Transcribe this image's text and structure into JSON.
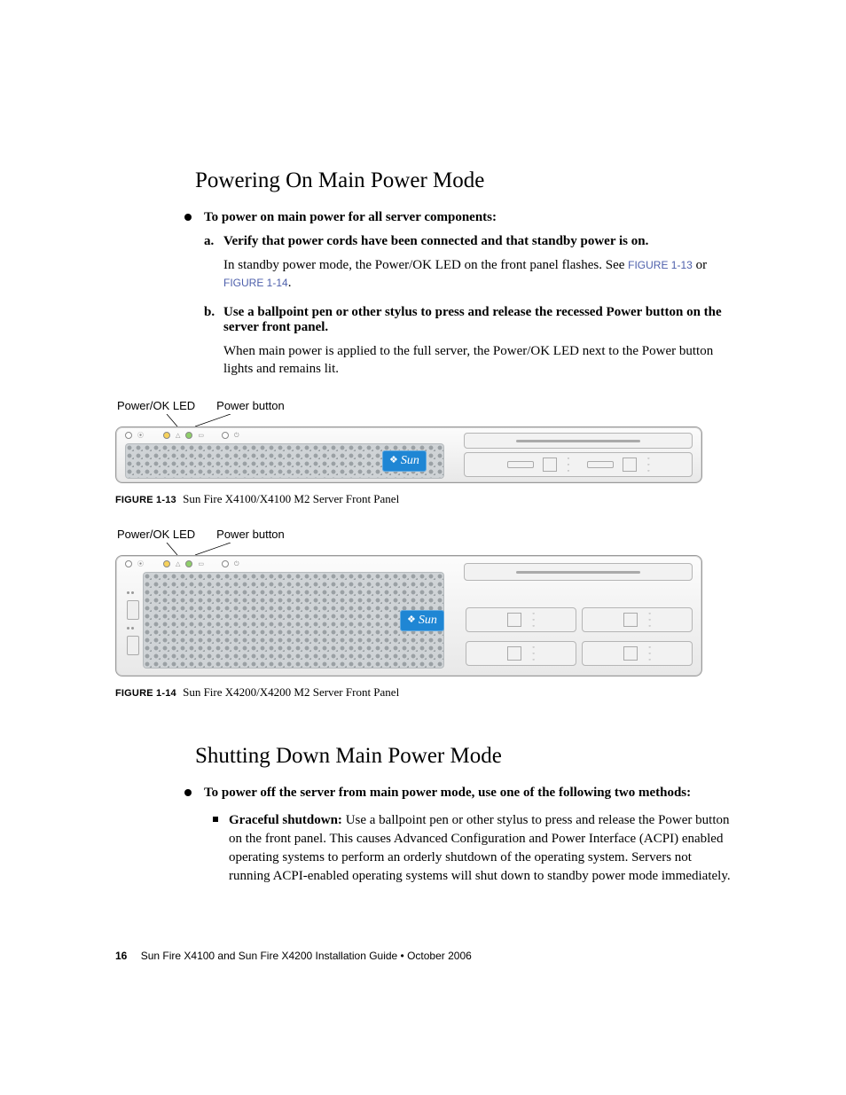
{
  "heading1": "Powering On Main Power Mode",
  "lead1": "To power on main power for all server components:",
  "steps": [
    {
      "marker": "a.",
      "head": "Verify that power cords have been connected and that standby power is on.",
      "body_pre": "In standby power mode, the Power/OK LED on the front panel flashes. See ",
      "xref1": "FIGURE 1-13",
      "mid": " or ",
      "xref2": "FIGURE 1-14",
      "post": "."
    },
    {
      "marker": "b.",
      "head": "Use a ballpoint pen or other stylus to press and release the recessed Power button on the server front panel.",
      "body": "When main power is applied to the full server, the Power/OK LED next to the Power button lights and remains lit."
    }
  ],
  "callout_led": "Power/OK LED",
  "callout_btn": "Power button",
  "sun_label": "Sun",
  "fig13_label": "FIGURE 1-13",
  "fig13_caption": "Sun Fire X4100/X4100 M2 Server Front Panel",
  "fig14_label": "FIGURE 1-14",
  "fig14_caption": "Sun Fire X4200/X4200 M2 Server Front Panel",
  "heading2": "Shutting Down Main Power Mode",
  "lead2": "To power off the server from main power mode, use one of the following two methods:",
  "shutdown_label": "Graceful shutdown:",
  "shutdown_body": " Use a ballpoint pen or other stylus to press and release the Power button on the front panel. This causes Advanced Configuration and Power Interface (ACPI) enabled operating systems to perform an orderly shutdown of the operating system. Servers not running ACPI-enabled operating systems will shut down to standby power mode immediately.",
  "footer_page": "16",
  "footer_text": "Sun Fire X4100 and Sun Fire X4200 Installation Guide  •  October 2006"
}
